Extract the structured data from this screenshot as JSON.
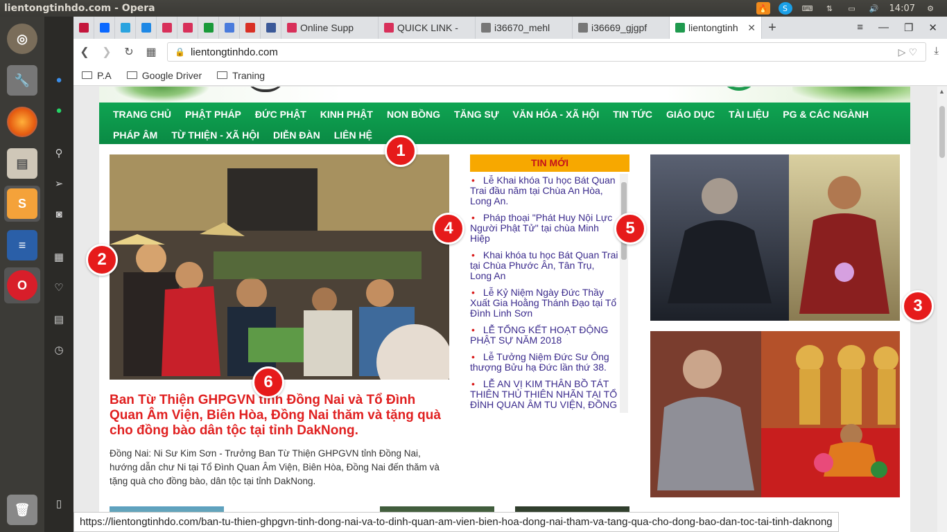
{
  "os": {
    "window_title": "lientongtinhdo.com - Opera",
    "clock": "14:07"
  },
  "tabs": [
    {
      "label": "",
      "icon": "opera-speed-dial-icon"
    },
    {
      "label": "",
      "icon": "zalo-icon"
    },
    {
      "label": "",
      "icon": "telegram-icon"
    },
    {
      "label": "",
      "icon": "chat-icon"
    },
    {
      "label": "",
      "icon": "site-icon"
    },
    {
      "label": "",
      "icon": "site-icon"
    },
    {
      "label": "",
      "icon": "plus-green-icon"
    },
    {
      "label": "",
      "icon": "translate-icon"
    },
    {
      "label": "",
      "icon": "gmail-icon"
    },
    {
      "label": "",
      "icon": "facebook-icon"
    },
    {
      "label": "Online Supp",
      "icon": "site-icon"
    },
    {
      "label": "QUICK LINK -",
      "icon": "site-icon"
    },
    {
      "label": "i36670_mehl",
      "icon": "document-icon"
    },
    {
      "label": "i36669_gjgpf",
      "icon": "document-icon"
    },
    {
      "label": "lientongtinh",
      "icon": "lientong-icon",
      "active": true
    }
  ],
  "address": {
    "url": "lientongtinhdo.com"
  },
  "bookmarks": [
    "P.A",
    "Google Driver",
    "Traning"
  ],
  "site": {
    "nav": [
      "TRANG CHỦ",
      "PHẬT PHÁP",
      "ĐỨC PHẬT",
      "KINH PHẬT",
      "NON BỒNG",
      "TĂNG SỰ",
      "VĂN HÓA - XÃ HỘI",
      "TIN TỨC",
      "GIÁO DỤC",
      "TÀI LIỆU",
      "PG & CÁC NGÀNH",
      "PHÁP ÂM",
      "TỪ THIỆN - XÃ HỘI",
      "DIỄN ĐÀN",
      "LIÊN HỆ"
    ],
    "headline": "Ban Từ Thiện GHPGVN tỉnh Đồng Nai và Tổ Đình Quan Âm Viện, Biên Hòa, Đồng Nai thăm và tặng quà cho đồng bào dân tộc tại tỉnh DakNong.",
    "summary": "Đồng Nai: Ni Sư Kim Sơn - Trưởng Ban Từ Thiện GHPGVN tỉnh Đồng Nai, hướng dẫn chư Ni tại Tổ Đình Quan Âm Viện, Biên Hòa, Đồng Nai đến thăm và tặng quà cho đồng bào, dân tộc tại tỉnh DakNong.",
    "news_header": "TIN MỚI",
    "news": [
      "Lễ Khai khóa Tu học Bát Quan Trai đầu năm tại Chùa An Hòa, Long An.",
      "Pháp thoại \"Phát Huy Nội Lực Người Phật Tử\" tại chùa Minh Hiệp",
      "Khai khóa tu học Bát Quan Trai tại Chùa Phước Ân, Tân Trụ, Long An",
      "Lễ Kỷ Niệm Ngày Đức Thầy Xuất Gia Hoằng Thánh Đạo tại Tổ Đình Linh Sơn",
      "LỄ TỔNG KẾT HOẠT ĐỘNG PHẬT SỰ NĂM 2018",
      "Lễ Tưởng Niệm Đức Sư Ông thượng Bửu hạ Đức lần thứ 38.",
      "LỄ AN VỊ KIM THÂN BỒ TÁT THIÊN THỦ THIÊN NHÃN TẠI TỔ ĐÌNH QUAN ÂM TU VIỆN, ĐỒNG"
    ]
  },
  "markers": [
    "1",
    "2",
    "3",
    "4",
    "5",
    "6"
  ],
  "status_url": "https://lientongtinhdo.com/ban-tu-thien-ghpgvn-tinh-dong-nai-va-to-dinh-quan-am-vien-bien-hoa-dong-nai-tham-va-tang-qua-cho-dong-bao-dan-toc-tai-tinh-daknong",
  "colors": {
    "nav_green": "#0a9a4a",
    "headline_red": "#e02020",
    "news_header_bg": "#f7a800",
    "marker_red": "#e61b1b"
  }
}
